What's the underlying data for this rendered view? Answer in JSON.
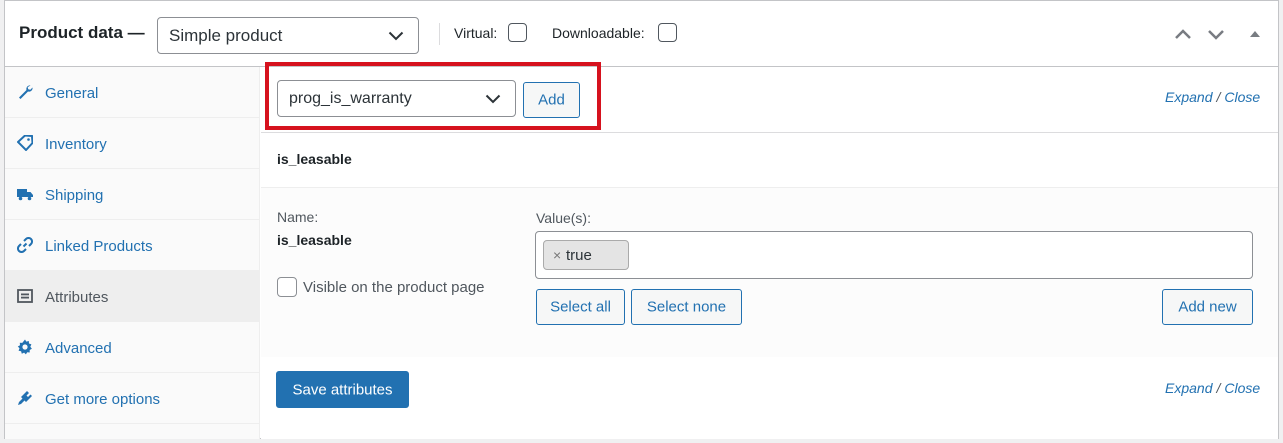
{
  "header": {
    "title": "Product data —",
    "product_type": "Simple product",
    "virtual_label": "Virtual:",
    "downloadable_label": "Downloadable:"
  },
  "sidebar": {
    "items": [
      {
        "label": "General",
        "icon": "wrench-icon"
      },
      {
        "label": "Inventory",
        "icon": "tag-icon"
      },
      {
        "label": "Shipping",
        "icon": "truck-icon"
      },
      {
        "label": "Linked Products",
        "icon": "link-icon"
      },
      {
        "label": "Attributes",
        "icon": "list-icon",
        "active": true
      },
      {
        "label": "Advanced",
        "icon": "gear-icon"
      },
      {
        "label": "Get more options",
        "icon": "plugin-icon"
      }
    ]
  },
  "toolbar": {
    "attribute_select": "prog_is_warranty",
    "add_label": "Add",
    "expand": "Expand",
    "close": "Close",
    "slash": "/"
  },
  "attribute": {
    "header_name": "is_leasable",
    "name_label": "Name:",
    "name_value": "is_leasable",
    "visible_label": "Visible on the product page",
    "values_label": "Value(s):",
    "chip_remove": "×",
    "chip_value": "true",
    "select_all": "Select all",
    "select_none": "Select none",
    "add_new": "Add new"
  },
  "footer": {
    "save_label": "Save attributes",
    "expand": "Expand",
    "close": "Close",
    "slash": "/"
  },
  "colors": {
    "accent": "#2271b1",
    "highlight": "#d6121e"
  }
}
